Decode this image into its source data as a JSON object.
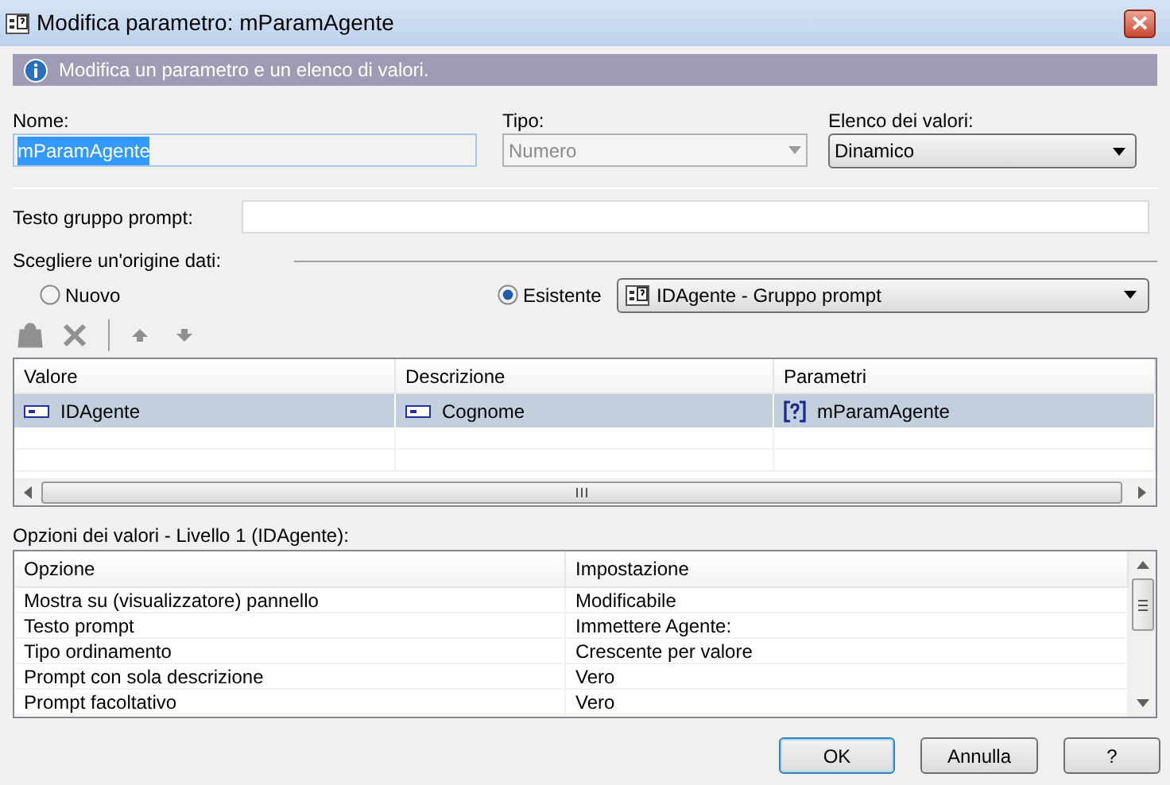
{
  "window": {
    "title": "Modifica parametro: mParamAgente"
  },
  "info_message": "Modifica un parametro e un elenco di valori.",
  "name_field": {
    "label": "Nome:",
    "value": "mParamAgente",
    "text_selected": true
  },
  "type_field": {
    "label": "Tipo:",
    "value": "Numero",
    "disabled": true
  },
  "values_list_field": {
    "label": "Elenco dei valori:",
    "value": "Dinamico",
    "disabled": false
  },
  "prompt_group_field": {
    "label": "Testo gruppo prompt:"
  },
  "data_source": {
    "label": "Scegliere un'origine dati:",
    "options": [
      {
        "label": "Nuovo",
        "selected": false
      },
      {
        "label": "Esistente",
        "selected": true
      }
    ],
    "source_select": {
      "value": "IDAgente - Gruppo prompt"
    }
  },
  "toolbar": [
    {
      "kind": "add",
      "disabled": true
    },
    {
      "kind": "delete",
      "disabled": true
    },
    {
      "kind": "up",
      "disabled": true
    },
    {
      "kind": "down",
      "disabled": true
    }
  ],
  "values_table": {
    "columns": [
      "Valore",
      "Descrizione",
      "Parametri"
    ],
    "rows": [
      {
        "selected": true,
        "cells": [
          {
            "kind": "field",
            "text": "IDAgente"
          },
          {
            "kind": "field",
            "text": "Cognome"
          },
          {
            "kind": "param",
            "text": "mParamAgente"
          }
        ]
      }
    ]
  },
  "options_label": "Opzioni dei valori - Livello 1 (IDAgente):",
  "options_table": {
    "columns": [
      "Opzione",
      "Impostazione"
    ],
    "rows": [
      [
        "Mostra su (visualizzatore) pannello",
        "Modificabile"
      ],
      [
        "Testo prompt",
        "Immettere Agente:"
      ],
      [
        "Tipo ordinamento",
        "Crescente per valore"
      ],
      [
        "Prompt con sola descrizione",
        "Vero"
      ],
      [
        "Prompt facoltativo",
        "Vero"
      ]
    ]
  },
  "buttons": [
    {
      "label": "OK",
      "default": true
    },
    {
      "label": "Annulla",
      "default": false
    },
    {
      "label": "?",
      "default": false
    }
  ]
}
